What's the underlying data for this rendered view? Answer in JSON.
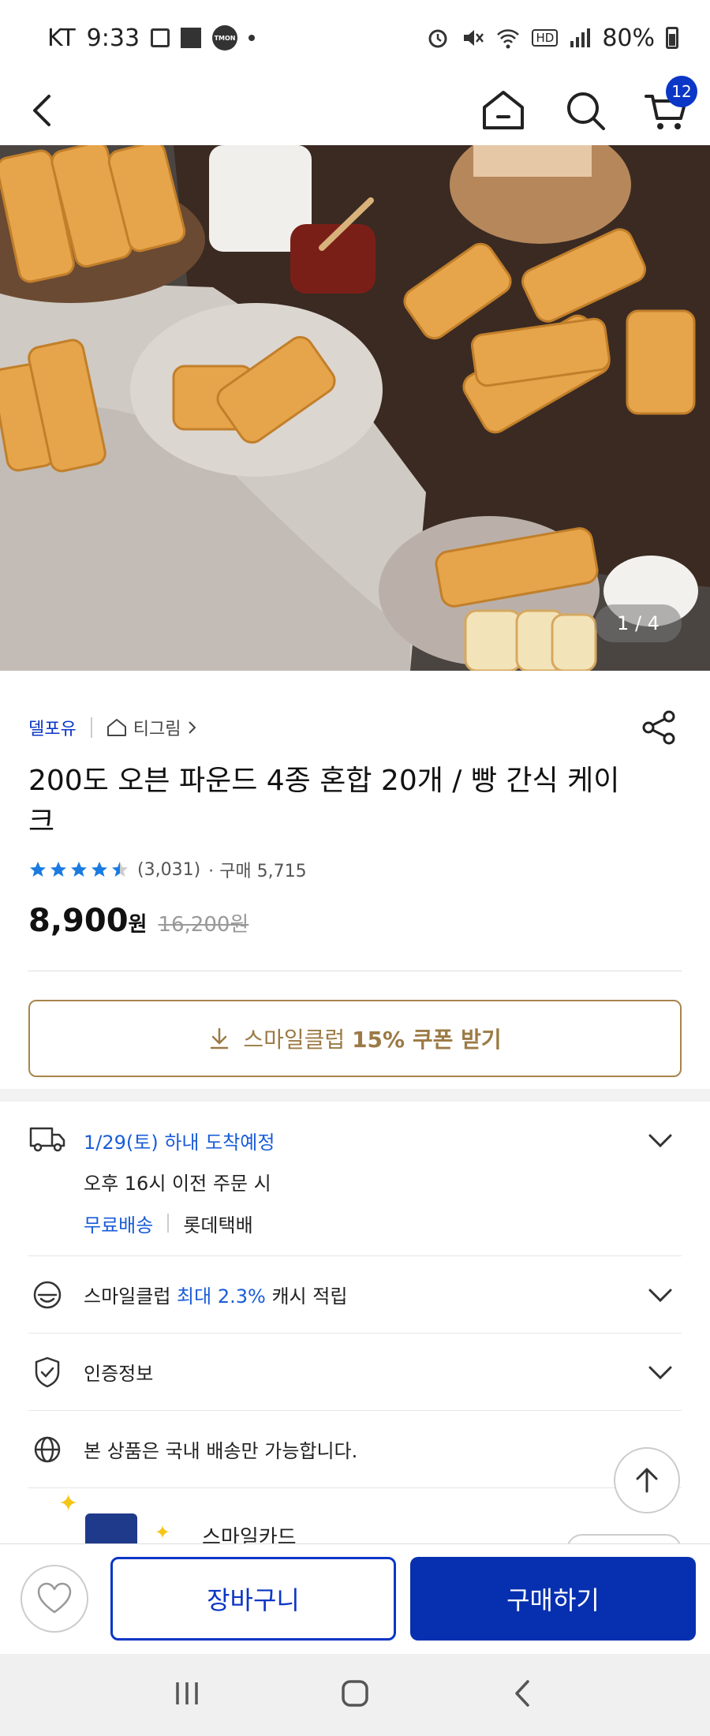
{
  "status_bar": {
    "carrier": "KT",
    "time": "9:33",
    "tmon_label": "TMON",
    "hd_label": "HD",
    "battery": "80%"
  },
  "nav": {
    "cart_count": "12"
  },
  "hero": {
    "counter": "1 / 4"
  },
  "product": {
    "seller": "델포유",
    "store": "티그림",
    "title": "200도 오븐 파운드 4종 혼합 20개 / 빵 간식 케이크",
    "rating": 4.5,
    "review_count": "(3,031)",
    "purchase_count": "· 구매 5,715",
    "price": "8,900",
    "price_unit": "원",
    "original_price": "16,200원"
  },
  "coupon": {
    "prefix": "스마일클럽",
    "highlight": "15% 쿠폰 받기"
  },
  "delivery": {
    "date": "1/29(토) 하내 도착예정",
    "cutoff": "오후 16시 이전 주문 시",
    "free_shipping": "무료배송",
    "courier": "롯데택배"
  },
  "cashback": {
    "prefix": "스마일클럽",
    "highlight": "최대 2.3%",
    "suffix": "캐시 적립"
  },
  "certification": {
    "label": "인증정보"
  },
  "domestic": {
    "label": "본 상품은 국내 배송만 가능합니다."
  },
  "card_banner": {
    "label": "스마일카드"
  },
  "actions": {
    "cart_label": "장바구니",
    "buy_label": "구매하기"
  },
  "colors": {
    "brand_blue": "#0b36c6",
    "coupon_gold": "#9b7a45",
    "star_blue": "#1a7be0"
  }
}
